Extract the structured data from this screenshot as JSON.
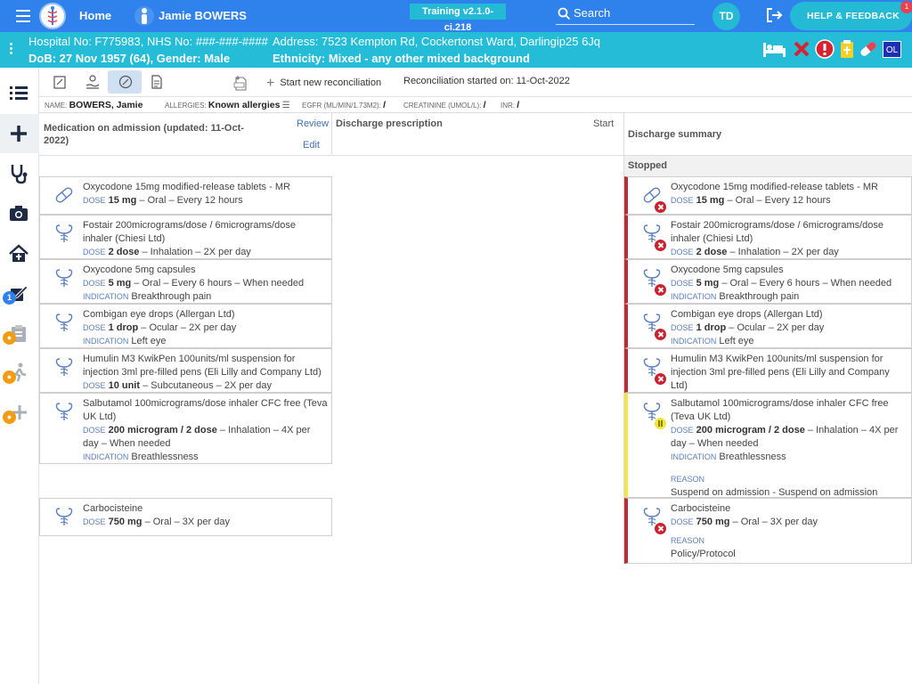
{
  "topbar": {
    "home": "Home",
    "patient_name": "Jamie BOWERS",
    "version": "Training v2.1.0-ci.218",
    "search": "Search",
    "user_initials": "TD",
    "help": "HELP & FEEDBACK",
    "help_badge": "1"
  },
  "banner": {
    "hospital_no": "Hospital No: F775983, NHS No: ###-###-####",
    "address": "Address: 7523 Kempton Rd, Cockertonst Ward, Darlingip25 6Jq",
    "dob": "DoB: 27 Nov 1957 (64), Gender: Male",
    "ethnicity": "Ethnicity: Mixed - any other mixed background",
    "ol": "OL"
  },
  "sidenav": {
    "badge_count": "1"
  },
  "toolbar": {
    "new_reconciliation": "Start new reconciliation",
    "started": "Reconciliation started on: 11-Oct-2022"
  },
  "infobar": {
    "name_label": "NAME:",
    "name": "BOWERS, Jamie",
    "allergies_label": "ALLERGIES:",
    "allergies": "Known allergies",
    "egfr_label": "EGFR (ML/MIN/1.73M2):",
    "egfr": "/",
    "creatinine_label": "CREATININE (UMOL/L):",
    "creatinine": "/",
    "inr_label": "INR:",
    "inr": "/"
  },
  "columns": {
    "admission_title": "Medication on admission (updated: 11-Oct-2022)",
    "review": "Review",
    "edit": "Edit",
    "discharge_title": "Discharge prescription",
    "start": "Start",
    "summary_title": "Discharge summary",
    "stopped": "Stopped"
  },
  "labels": {
    "dose": "DOSE",
    "indication": "INDICATION",
    "reason": "REASON"
  },
  "admission_meds": [
    {
      "name": "Oxycodone 15mg modified-release tablets - MR",
      "dose": "15 mg",
      "route": "– Oral – Every 12 hours"
    },
    {
      "name": "Fostair 200micrograms/dose / 6micrograms/dose inhaler (Chiesi Ltd)",
      "dose": "2 dose",
      "route": "– Inhalation – 2X per day"
    },
    {
      "name": "Oxycodone 5mg capsules",
      "dose": "5 mg",
      "route": "– Oral – Every 6 hours – When needed",
      "indication": "Breakthrough pain"
    },
    {
      "name": "Combigan eye drops (Allergan Ltd)",
      "dose": "1 drop",
      "route": "– Ocular – 2X per day",
      "indication": "Left eye"
    },
    {
      "name": "Humulin M3 KwikPen 100units/ml suspension for injection 3ml pre-filled pens (Eli Lilly and Company Ltd)",
      "dose": "10 unit",
      "route": "– Subcutaneous – 2X per day"
    },
    {
      "name": "Salbutamol 100micrograms/dose inhaler CFC free (Teva UK Ltd)",
      "dose": "200 microgram / 2 dose",
      "route": "– Inhalation – 4X per day – When needed",
      "indication": "Breathlessness"
    },
    {
      "name": "Carbocisteine",
      "dose": "750 mg",
      "route": "– Oral – 3X per day"
    }
  ],
  "summary_meds": [
    {
      "name": "Oxycodone 15mg modified-release tablets - MR",
      "dose": "15 mg",
      "route": "– Oral – Every 12 hours"
    },
    {
      "name": "Fostair 200micrograms/dose / 6micrograms/dose inhaler (Chiesi Ltd)",
      "dose": "2 dose",
      "route": "– Inhalation – 2X per day"
    },
    {
      "name": "Oxycodone 5mg capsules",
      "dose": "5 mg",
      "route": "– Oral – Every 6 hours – When needed",
      "indication": "Breakthrough pain"
    },
    {
      "name": "Combigan eye drops (Allergan Ltd)",
      "dose": "1 drop",
      "route": "– Ocular – 2X per day",
      "indication": "Left eye"
    },
    {
      "name": "Humulin M3 KwikPen 100units/ml suspension for injection 3ml pre-filled pens (Eli Lilly and Company Ltd)",
      "dose": "10 unit",
      "route": "– Subcutaneous – 2X per day"
    },
    {
      "name": "Salbutamol 100micrograms/dose inhaler CFC free (Teva UK Ltd)",
      "dose": "200 microgram / 2 dose",
      "route": "– Inhalation – 4X per day – When needed",
      "indication": "Breathlessness",
      "reason": "Suspend on admission - Suspend on admission"
    },
    {
      "name": "Carbocisteine",
      "dose": "750 mg",
      "route": "– Oral – 3X per day",
      "reason": "Policy/Protocol"
    }
  ],
  "colors": {
    "primary": "#2f82ec",
    "banner": "#24bcd6",
    "stopped": "#c02a36",
    "suspended": "#f3e545"
  }
}
